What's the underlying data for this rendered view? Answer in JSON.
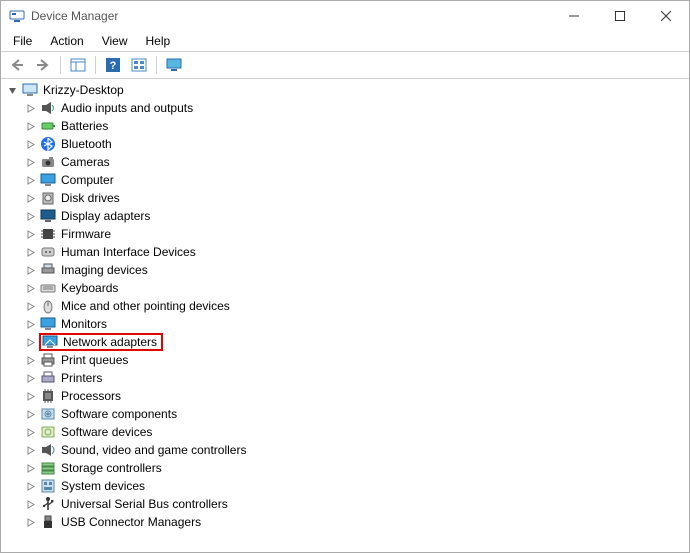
{
  "window": {
    "title": "Device Manager"
  },
  "menus": {
    "file": "File",
    "action": "Action",
    "view": "View",
    "help": "Help"
  },
  "tree": {
    "root": "Krizzy-Desktop",
    "items": [
      {
        "label": "Audio inputs and outputs",
        "icon": "speaker"
      },
      {
        "label": "Batteries",
        "icon": "battery"
      },
      {
        "label": "Bluetooth",
        "icon": "bluetooth"
      },
      {
        "label": "Cameras",
        "icon": "camera"
      },
      {
        "label": "Computer",
        "icon": "monitor"
      },
      {
        "label": "Disk drives",
        "icon": "disk"
      },
      {
        "label": "Display adapters",
        "icon": "display"
      },
      {
        "label": "Firmware",
        "icon": "chip"
      },
      {
        "label": "Human Interface Devices",
        "icon": "hid"
      },
      {
        "label": "Imaging devices",
        "icon": "scanner"
      },
      {
        "label": "Keyboards",
        "icon": "keyboard"
      },
      {
        "label": "Mice and other pointing devices",
        "icon": "mouse"
      },
      {
        "label": "Monitors",
        "icon": "monitor2"
      },
      {
        "label": "Network adapters",
        "icon": "network",
        "highlighted": true
      },
      {
        "label": "Print queues",
        "icon": "printer"
      },
      {
        "label": "Printers",
        "icon": "printer2"
      },
      {
        "label": "Processors",
        "icon": "cpu"
      },
      {
        "label": "Software components",
        "icon": "software"
      },
      {
        "label": "Software devices",
        "icon": "software2"
      },
      {
        "label": "Sound, video and game controllers",
        "icon": "sound"
      },
      {
        "label": "Storage controllers",
        "icon": "storage"
      },
      {
        "label": "System devices",
        "icon": "system"
      },
      {
        "label": "Universal Serial Bus controllers",
        "icon": "usb"
      },
      {
        "label": "USB Connector Managers",
        "icon": "usbconn"
      }
    ]
  }
}
